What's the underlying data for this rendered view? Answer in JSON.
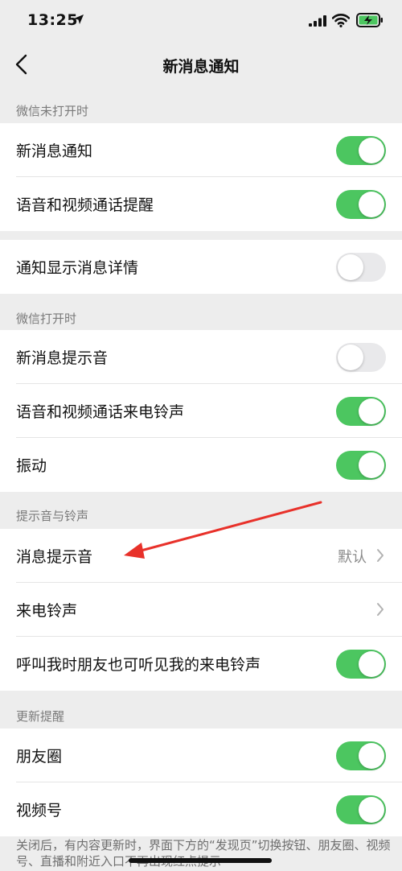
{
  "status_bar": {
    "time": "13:25"
  },
  "nav": {
    "title": "新消息通知"
  },
  "sections": [
    {
      "label": "微信未打开时"
    },
    {
      "label": "微信打开时"
    },
    {
      "label": "提示音与铃声"
    },
    {
      "label": "更新提醒"
    }
  ],
  "rows": {
    "new_message_notify": {
      "label": "新消息通知",
      "on": true
    },
    "voice_video_reminder": {
      "label": "语音和视频通话提醒",
      "on": true
    },
    "show_details": {
      "label": "通知显示消息详情",
      "on": false
    },
    "message_tone": {
      "label": "新消息提示音",
      "on": false
    },
    "call_ringtone": {
      "label": "语音和视频通话来电铃声",
      "on": true
    },
    "vibrate": {
      "label": "振动",
      "on": true
    },
    "message_sound": {
      "label": "消息提示音",
      "value": "默认"
    },
    "ringtone": {
      "label": "来电铃声"
    },
    "friends_hear_ringtone": {
      "label": "呼叫我时朋友也可听见我的来电铃声",
      "on": true
    },
    "moments": {
      "label": "朋友圈",
      "on": true
    },
    "channels": {
      "label": "视频号",
      "on": true
    }
  },
  "footnote": "关闭后，有内容更新时，界面下方的“发现页”切换按钮、朋友圈、视频号、直播和附近入口不再出现红点提示",
  "colors": {
    "toggle_on": "#4cc660",
    "toggle_off": "#e9e9eb",
    "background": "#ededed",
    "annotation_arrow": "#e8312a"
  },
  "icons": [
    "location-arrow-icon",
    "cellular-signal-icon",
    "wifi-icon",
    "battery-charging-icon",
    "back-chevron-icon",
    "chevron-right-icon"
  ]
}
